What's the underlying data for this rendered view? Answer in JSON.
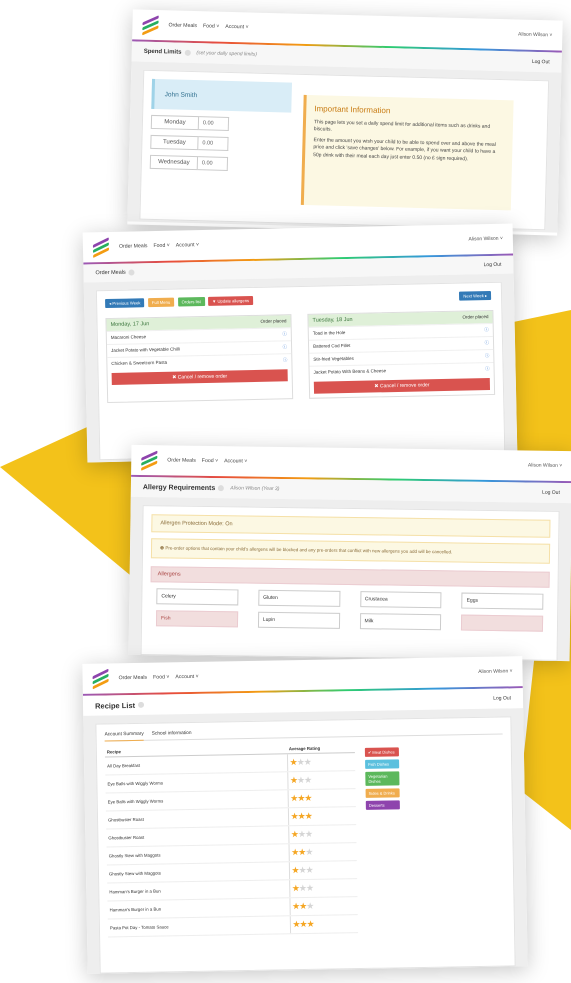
{
  "colors": {
    "yellow": "#F3C21A",
    "green": "#5cb85c",
    "red": "#d9534f",
    "blue": "#337ab7",
    "orange": "#f0ad4e",
    "purple": "#8e44ad",
    "teal": "#5bc0de"
  },
  "nav": {
    "order_meals": "Order Meals",
    "food": "Food ˅",
    "account": "Account ˅",
    "user": "Alison Wilson ˅",
    "logout": "Log Out"
  },
  "spend": {
    "title": "Spend Limits",
    "hint": "(set your daily spend limits)",
    "child": "John Smith",
    "days": [
      {
        "label": "Monday",
        "value": "0.00"
      },
      {
        "label": "Tuesday",
        "value": "0.00"
      },
      {
        "label": "Wednesday",
        "value": "0.00"
      }
    ],
    "info_title": "Important Information",
    "info_p1": "This page lets you set a daily spend limit for additional items such as drinks and biscuits.",
    "info_p2": "Enter the amount you wish your child to be able to spend over and above the meal price and click 'save changes' below. For example, if you want your child to have a 50p drink with their meal each day just enter 0.50 (no £ sign required)."
  },
  "orders": {
    "title": "Order Meals",
    "user": "Alison Wilson ˅",
    "buttons": {
      "prev": "◂ Previous Week",
      "full": "Full Menu",
      "history": "Orders list",
      "allergens": "▼ Update allergens",
      "next": "Next Week ▸"
    },
    "monday": {
      "label": "Monday, 17 Jun",
      "status": "Order placed",
      "items": [
        "Macaroni Cheese",
        "Jacket Potato with Vegetable Chilli",
        "Chicken & Sweetcorn Pasta"
      ]
    },
    "tuesday": {
      "label": "Tuesday, 18 Jun",
      "status": "Order placed",
      "items": [
        "Toad in the Hole",
        "Battered Cod Fillet",
        "Stir-fried Vegetables",
        "Jacket Potato With Beans & Cheese"
      ]
    },
    "cancel": "✖ Cancel / remove order"
  },
  "allergy": {
    "title": "Allergy Requirements",
    "child": "Alison Wilson (Year 3)",
    "mode": "Allergen Protection Mode: On",
    "note": "❶ Pre-order options that contain your child's allergens will be blocked and any pre-orders that conflict with new allergens you add will be cancelled.",
    "allergens_label": "Allergens",
    "allergens": [
      "Celery",
      "Gluten",
      "Crustacea",
      "Eggs",
      "Fish",
      "Lupin",
      "Milk",
      ""
    ]
  },
  "recipes": {
    "title": "Recipe List",
    "tabs": [
      "Account Summary",
      "School information"
    ],
    "col_recipe": "Recipe",
    "col_rating": "Average Rating",
    "rows": [
      {
        "name": "All Day Breakfast",
        "rating": 1
      },
      {
        "name": "Eye Balls with Wiggly Worms",
        "rating": 1
      },
      {
        "name": "Eye Balls with Wiggly Worms",
        "rating": 3
      },
      {
        "name": "Ghostbuster Roast",
        "rating": 3
      },
      {
        "name": "Ghostbuster Roast",
        "rating": 1
      },
      {
        "name": "Ghostly Stew with Maggots",
        "rating": 2
      },
      {
        "name": "Ghostly Stew with Maggots",
        "rating": 1
      },
      {
        "name": "Hamman's Burger in a Bun",
        "rating": 1
      },
      {
        "name": "Hamman's Burger in a Bun",
        "rating": 2
      },
      {
        "name": "Pasta Pot Day - Tomato Sauce",
        "rating": 3
      }
    ],
    "categories": [
      "✔ Meat Dishes",
      "Fish Dishes",
      "Vegetarian Dishes",
      "Sides & Drinks",
      "Desserts"
    ]
  }
}
